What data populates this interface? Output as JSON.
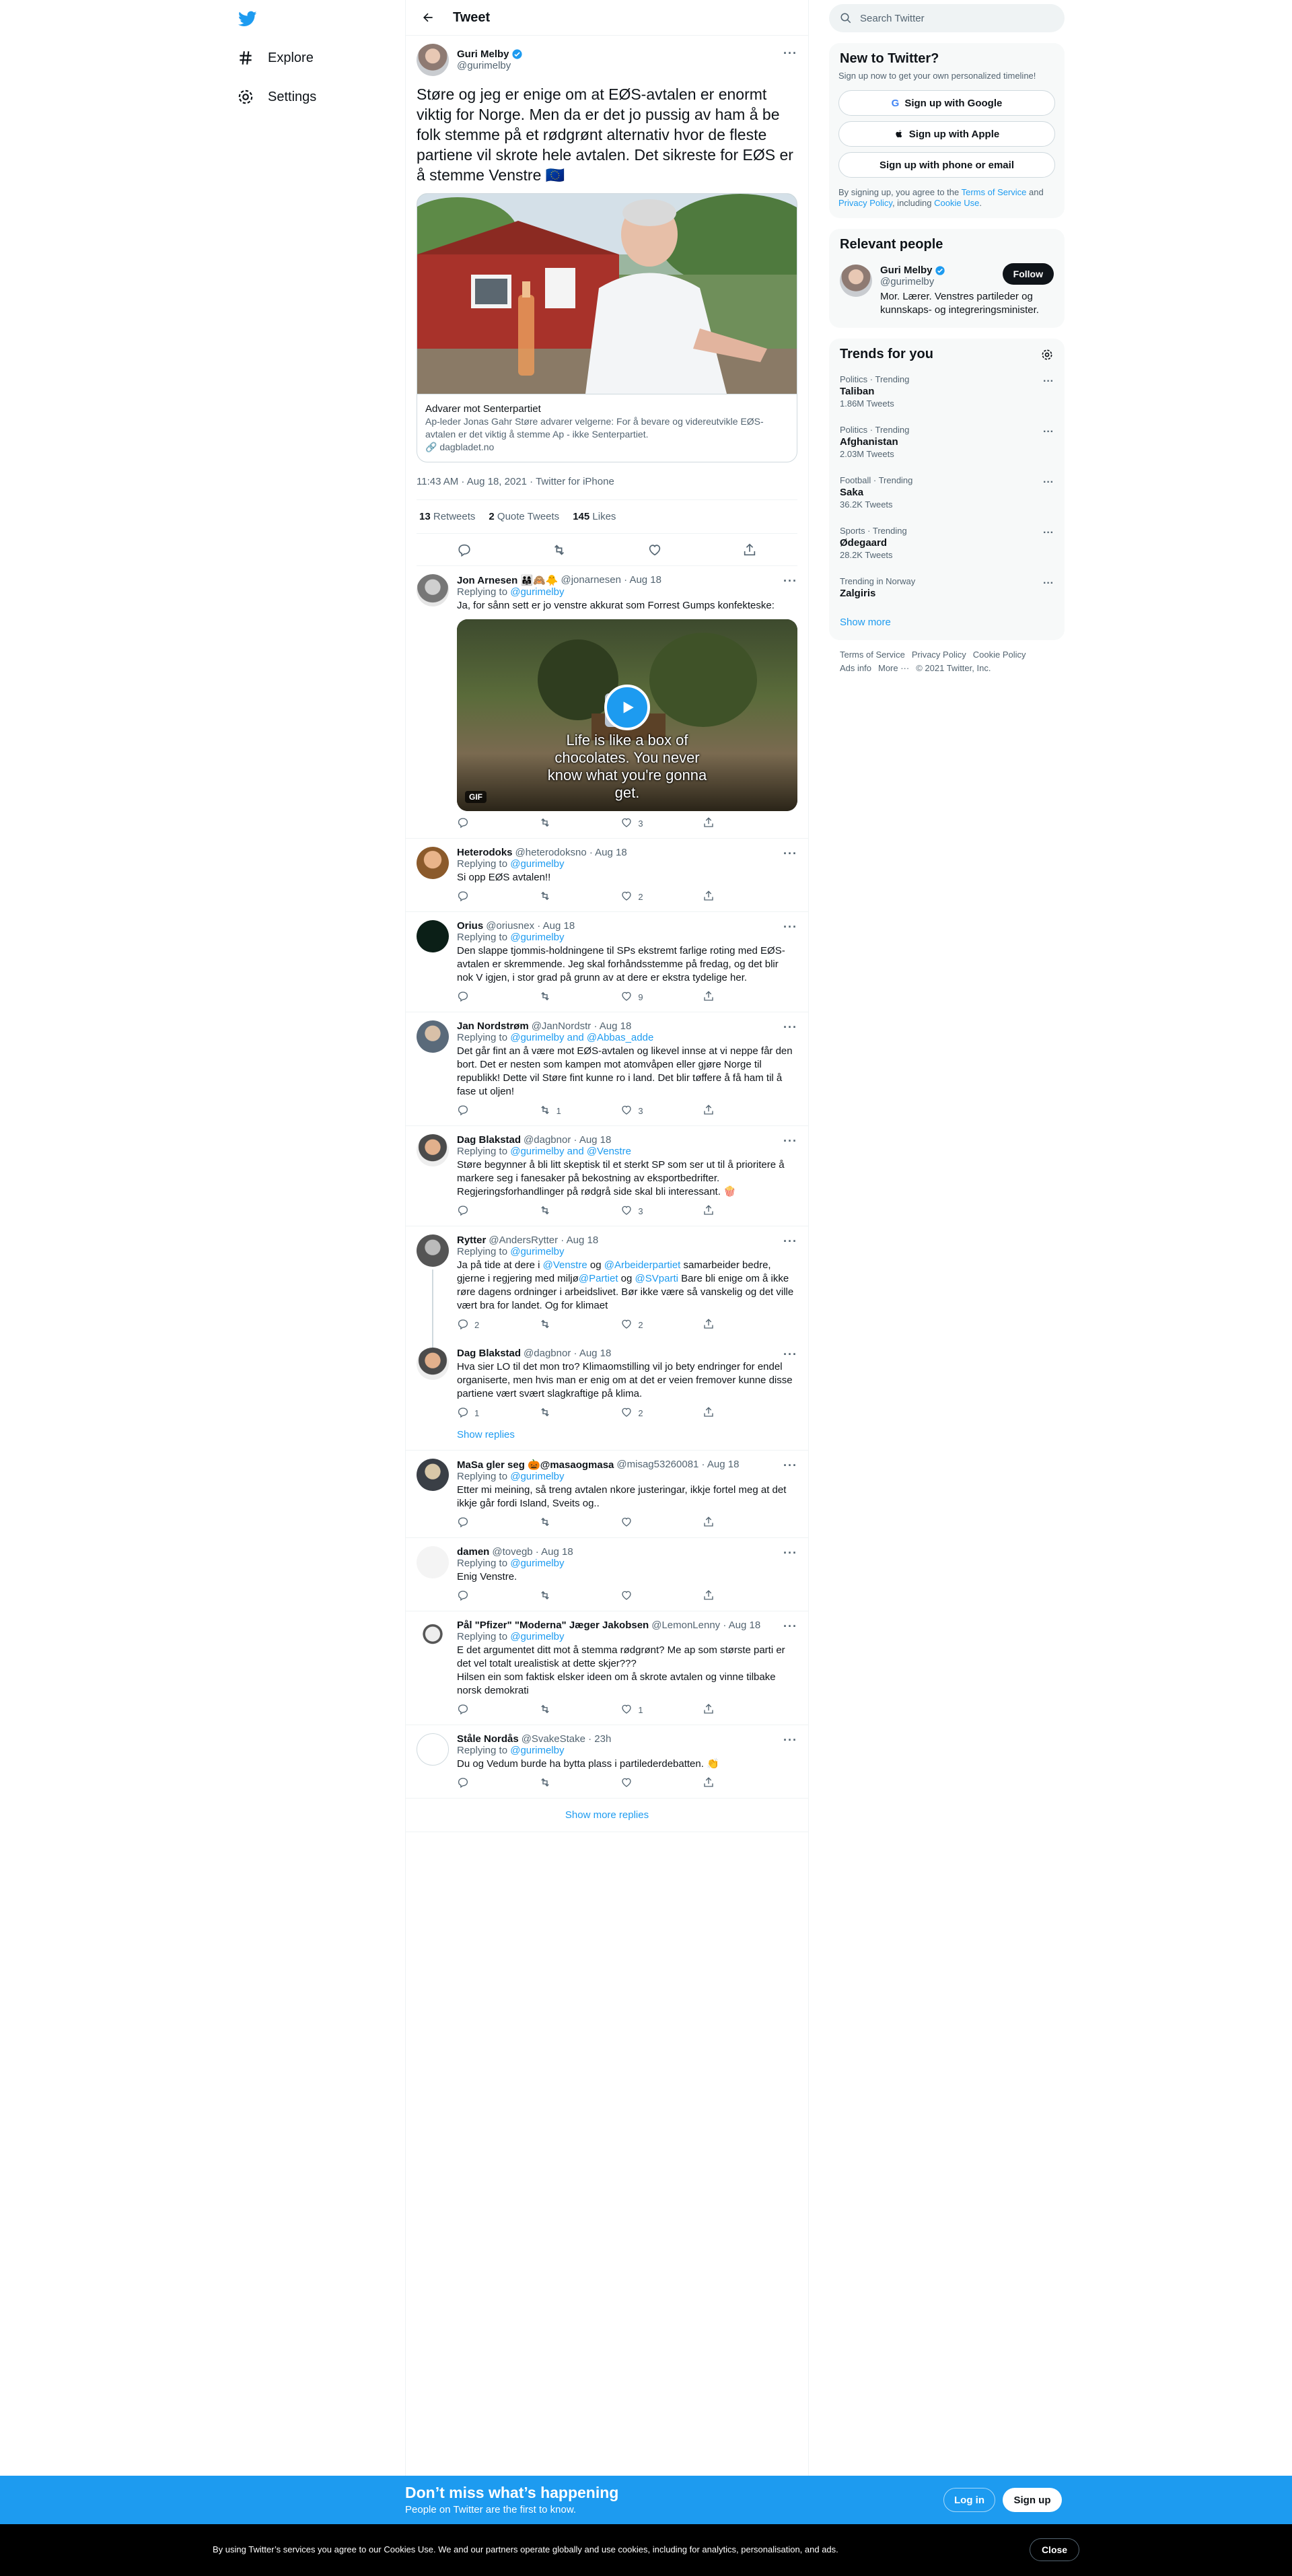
{
  "nav": {
    "explore": "Explore",
    "settings": "Settings"
  },
  "header": {
    "title": "Tweet"
  },
  "main_tweet": {
    "name": "Guri Melby",
    "handle": "@gurimelby",
    "text": "Støre og jeg er enige om at EØS-avtalen er enormt viktig for Norge. Men da er det jo pussig av ham å be folk stemme på et rødgrønt alternativ hvor de fleste partiene vil skrote hele avtalen. Det sikreste for EØS er å stemme Venstre 🇪🇺",
    "card_title": "Advarer mot Senterpartiet",
    "card_desc": "Ap-leder Jonas Gahr Støre advarer velgerne: For å bevare og videreutvikle EØS-avtalen er det viktig å stemme Ap - ikke Senterpartiet.",
    "card_source": "dagbladet.no",
    "timestamp": "11:43 AM · Aug 18, 2021 · Twitter for iPhone",
    "retweets": "13",
    "retweets_label": "Retweets",
    "quotes": "2",
    "quotes_label": "Quote Tweets",
    "likes": "145",
    "likes_label": "Likes"
  },
  "replies": [
    {
      "name": "Jon Arnesen 👨‍👩‍👧🙈🐥",
      "handle": "@jonarnesen · Aug 18",
      "to": "@gurimelby",
      "text": "Ja, for sånn sett er jo venstre akkurat som Forrest Gumps konfekteske:",
      "reply": "",
      "rt": "",
      "like": "3",
      "gif_caption": "Life is like a box of chocolates. You never know what you're gonna get.",
      "gif_label": "GIF"
    },
    {
      "name": "Heterodoks",
      "handle": "@heterodoksno · Aug 18",
      "to": "@gurimelby",
      "text": "Si opp EØS avtalen!!",
      "reply": "",
      "rt": "",
      "like": "2"
    },
    {
      "name": "Orius",
      "handle": "@oriusnex · Aug 18",
      "to": "@gurimelby",
      "text": "Den slappe tjommis-holdningene til SPs ekstremt farlige roting med EØS-avtalen er skremmende. Jeg skal forhåndsstemme på fredag, og det blir nok V igjen, i stor grad på grunn av at dere er ekstra tydelige her.",
      "reply": "",
      "rt": "",
      "like": "9"
    },
    {
      "name": "Jan Nordstrøm",
      "handle": "@JanNordstr · Aug 18",
      "to": "@gurimelby and @Abbas_adde",
      "text": "Det går fint an å være mot EØS-avtalen og likevel innse at vi neppe får den bort. Det er nesten som kampen mot atomvåpen eller gjøre Norge til republikk! Dette vil Støre fint kunne ro i land. Det blir tøffere å få ham til å fase ut oljen!",
      "reply": "",
      "rt": "1",
      "like": "3"
    },
    {
      "name": "Dag Blakstad",
      "handle": "@dagbnor · Aug 18",
      "to": "@gurimelby and @Venstre",
      "text": "Støre begynner å bli litt skeptisk til et sterkt SP som ser ut til å prioritere å markere seg i fanesaker på bekostning av eksportbedrifter. Regjeringsforhandlinger på rødgrå side skal bli interessant. 🍿",
      "reply": "",
      "rt": "",
      "like": "3"
    },
    {
      "name": "Rytter",
      "handle": "@AndersRytter · Aug 18",
      "to": "@gurimelby",
      "text_parts": [
        "Ja på tide at dere i ",
        "@Venstre",
        " og ",
        "@Arbeiderpartiet",
        " samarbeider bedre, gjerne i regjering med miljø",
        "@Partiet",
        " og ",
        "@SVparti",
        " Bare bli enige om å ikke røre dagens ordninger i arbeidslivet. Bør ikke være så vanskelig og det ville vært bra for landet. Og for klimaet"
      ],
      "reply": "2",
      "rt": "",
      "like": "2"
    },
    {
      "name": "Dag Blakstad",
      "handle": "@dagbnor · Aug 18",
      "text": "Hva sier LO til det mon tro? Klimaomstilling vil jo bety endringer for endel organiserte, men hvis man er enig om at det er veien fremover kunne disse partiene vært svært slagkraftige på klima.",
      "reply": "1",
      "rt": "",
      "like": "2",
      "show_replies": "Show replies"
    },
    {
      "name": "MaSa gler seg 🎃@masaogmasa",
      "handle": "@misag53260081 · Aug 18",
      "to": "@gurimelby",
      "text": "Etter mi meining, så treng avtalen nkore justeringar, ikkje fortel meg at det ikkje går fordi Island, Sveits og..",
      "reply": "",
      "rt": "",
      "like": ""
    },
    {
      "name": "damen",
      "handle": "@tovegb · Aug 18",
      "to": "@gurimelby",
      "text": "Enig Venstre.",
      "reply": "",
      "rt": "",
      "like": ""
    },
    {
      "name": "Pål \"Pfizer\" \"Moderna\" Jæger Jakobsen",
      "handle": "@LemonLenny · Aug 18",
      "to": "@gurimelby",
      "text": "E det argumentet ditt mot å stemma rødgrønt? Me ap som største parti er det vel totalt urealistisk at dette skjer???\nHilsen ein som faktisk elsker ideen om å skrote avtalen og vinne tilbake norsk demokrati",
      "reply": "",
      "rt": "",
      "like": "1"
    },
    {
      "name": "Ståle Nordås",
      "handle": "@SvakeStake · 23h",
      "to": "@gurimelby",
      "text": "Du og Vedum burde ha bytta plass i partilederdebatten. 👏",
      "reply": "",
      "rt": "",
      "like": ""
    }
  ],
  "replying_to_label": "Replying to",
  "show_more_replies": "Show more replies",
  "right": {
    "search_placeholder": "Search Twitter",
    "new_title": "New to Twitter?",
    "new_sub": "Sign up now to get your own personalized timeline!",
    "btn_google": "Sign up with Google",
    "btn_apple": "Sign up with Apple",
    "btn_phone": "Sign up with phone or email",
    "terms_pre": "By signing up, you agree to the ",
    "terms_tos": "Terms of Service",
    "terms_and": " and ",
    "terms_pp": "Privacy Policy",
    "terms_incl": ", including ",
    "terms_cookie": "Cookie Use",
    "terms_end": ".",
    "relevant_title": "Relevant people",
    "person_name": "Guri Melby",
    "person_handle": "@gurimelby",
    "person_bio": "Mor. Lærer. Venstres partileder og kunnskaps- og integreringsminister.",
    "follow": "Follow",
    "trends_title": "Trends for you",
    "trends": [
      {
        "cat": "Politics · Trending",
        "topic": "Taliban",
        "count": "1.86M Tweets"
      },
      {
        "cat": "Politics · Trending",
        "topic": "Afghanistan",
        "count": "2.03M Tweets"
      },
      {
        "cat": "Football · Trending",
        "topic": "Saka",
        "count": "36.2K Tweets"
      },
      {
        "cat": "Sports · Trending",
        "topic": "Ødegaard",
        "count": "28.2K Tweets"
      },
      {
        "cat": "Trending in Norway",
        "topic": "Zalgiris",
        "count": ""
      }
    ],
    "show_more": "Show more",
    "footer": [
      "Terms of Service",
      "Privacy Policy",
      "Cookie Policy",
      "Ads info",
      "More ···",
      "© 2021 Twitter, Inc."
    ]
  },
  "banner": {
    "title": "Don’t miss what’s happening",
    "sub": "People on Twitter are the first to know.",
    "login": "Log in",
    "signup": "Sign up"
  },
  "cookie": {
    "text": "By using Twitter’s services you agree to our Cookies Use. We and our partners operate globally and use cookies, including for analytics, personalisation, and ads.",
    "close": "Close"
  },
  "colors": {
    "accent": "#1d9bf0",
    "text": "#0f1419",
    "muted": "#536471"
  }
}
